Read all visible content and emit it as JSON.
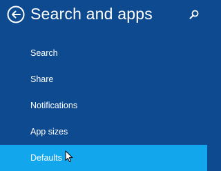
{
  "header": {
    "title": "Search and apps",
    "back_icon": "back-arrow-circle-icon",
    "search_icon": "search-icon"
  },
  "nav": {
    "items": [
      {
        "label": "Search",
        "selected": false
      },
      {
        "label": "Share",
        "selected": false
      },
      {
        "label": "Notifications",
        "selected": false
      },
      {
        "label": "App sizes",
        "selected": false
      },
      {
        "label": "Defaults",
        "selected": true
      }
    ]
  },
  "colors": {
    "background": "#0d4a8f",
    "selected_background": "#12a6ec",
    "text": "#ffffff"
  }
}
